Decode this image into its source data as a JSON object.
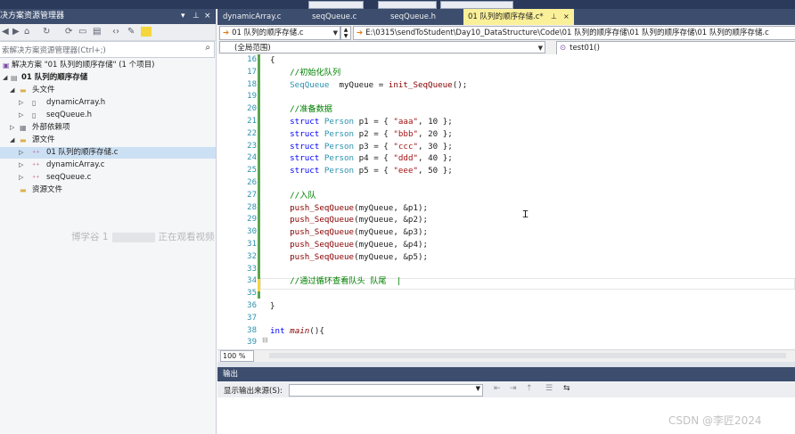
{
  "solution_explorer": {
    "title": "决方案资源管理器",
    "title_buttons": [
      "▾",
      "⊥",
      "×"
    ],
    "search_placeholder": "索解决方案资源管理器(Ctrl+;)",
    "tree": [
      {
        "label": "解决方案 \"01 队列的顺序存储\" (1 个项目)",
        "icon": "solution-icon"
      },
      {
        "label": "01 队列的顺序存储",
        "icon": "project-icon"
      },
      {
        "label": "头文件",
        "icon": "folder-icon"
      },
      {
        "label": "dynamicArray.h",
        "icon": "header-file-icon"
      },
      {
        "label": "seqQueue.h",
        "icon": "header-file-icon"
      },
      {
        "label": "外部依赖项",
        "icon": "dependencies-icon"
      },
      {
        "label": "源文件",
        "icon": "folder-icon"
      },
      {
        "label": "01 队列的顺序存储.c",
        "icon": "source-file-icon"
      },
      {
        "label": "dynamicArray.c",
        "icon": "source-file-icon"
      },
      {
        "label": "seqQueue.c",
        "icon": "source-file-icon"
      },
      {
        "label": "资源文件",
        "icon": "folder-icon"
      }
    ],
    "watermark_left": "博学谷 1",
    "watermark_right": "正在观看视频"
  },
  "editor": {
    "tabs": [
      {
        "label": "dynamicArray.c",
        "active": false
      },
      {
        "label": "seqQueue.c",
        "active": false
      },
      {
        "label": "seqQueue.h",
        "active": false
      },
      {
        "label": "01 队列的顺序存储.c*",
        "active": true
      }
    ],
    "tab_pin": "⊥",
    "tab_close": "×",
    "file_dropdown": "01 队列的顺序存储.c",
    "path_dropdown": "E:\\0315\\sendToStudent\\Day10_DataStructure\\Code\\01 队列的顺序存储\\01 队列的顺序存储\\01 队列的顺序存储.c",
    "scope_dropdown": "(全局范围)",
    "function_dropdown": "test01()",
    "zoom": "100 %",
    "lines": [
      {
        "n": "16",
        "text": "{"
      },
      {
        "n": "17",
        "text": "    //初始化队列"
      },
      {
        "n": "18",
        "text": "    SeqQueue  myQueue = init_SeqQueue();"
      },
      {
        "n": "19",
        "text": ""
      },
      {
        "n": "20",
        "text": "    //准备数据"
      },
      {
        "n": "21",
        "text": "    struct Person p1 = { \"aaa\", 10 };"
      },
      {
        "n": "22",
        "text": "    struct Person p2 = { \"bbb\", 20 };"
      },
      {
        "n": "23",
        "text": "    struct Person p3 = { \"ccc\", 30 };"
      },
      {
        "n": "24",
        "text": "    struct Person p4 = { \"ddd\", 40 };"
      },
      {
        "n": "25",
        "text": "    struct Person p5 = { \"eee\", 50 };"
      },
      {
        "n": "26",
        "text": ""
      },
      {
        "n": "27",
        "text": "    //入队"
      },
      {
        "n": "28",
        "text": "    push_SeqQueue(myQueue, &p1);"
      },
      {
        "n": "29",
        "text": "    push_SeqQueue(myQueue, &p2);"
      },
      {
        "n": "30",
        "text": "    push_SeqQueue(myQueue, &p3);"
      },
      {
        "n": "31",
        "text": "    push_SeqQueue(myQueue, &p4);"
      },
      {
        "n": "32",
        "text": "    push_SeqQueue(myQueue, &p5);"
      },
      {
        "n": "33",
        "text": ""
      },
      {
        "n": "34",
        "text": "    //通过循环查看队头 队尾  |"
      },
      {
        "n": "35",
        "text": ""
      },
      {
        "n": "36",
        "text": "}"
      },
      {
        "n": "37",
        "text": ""
      },
      {
        "n": "38",
        "text": "int main(){"
      },
      {
        "n": "39",
        "text": ""
      }
    ]
  },
  "output": {
    "title": "输出",
    "source_label": "显示输出来源(S):",
    "source_value": ""
  },
  "csdn_watermark": "CSDN @李匠2024"
}
